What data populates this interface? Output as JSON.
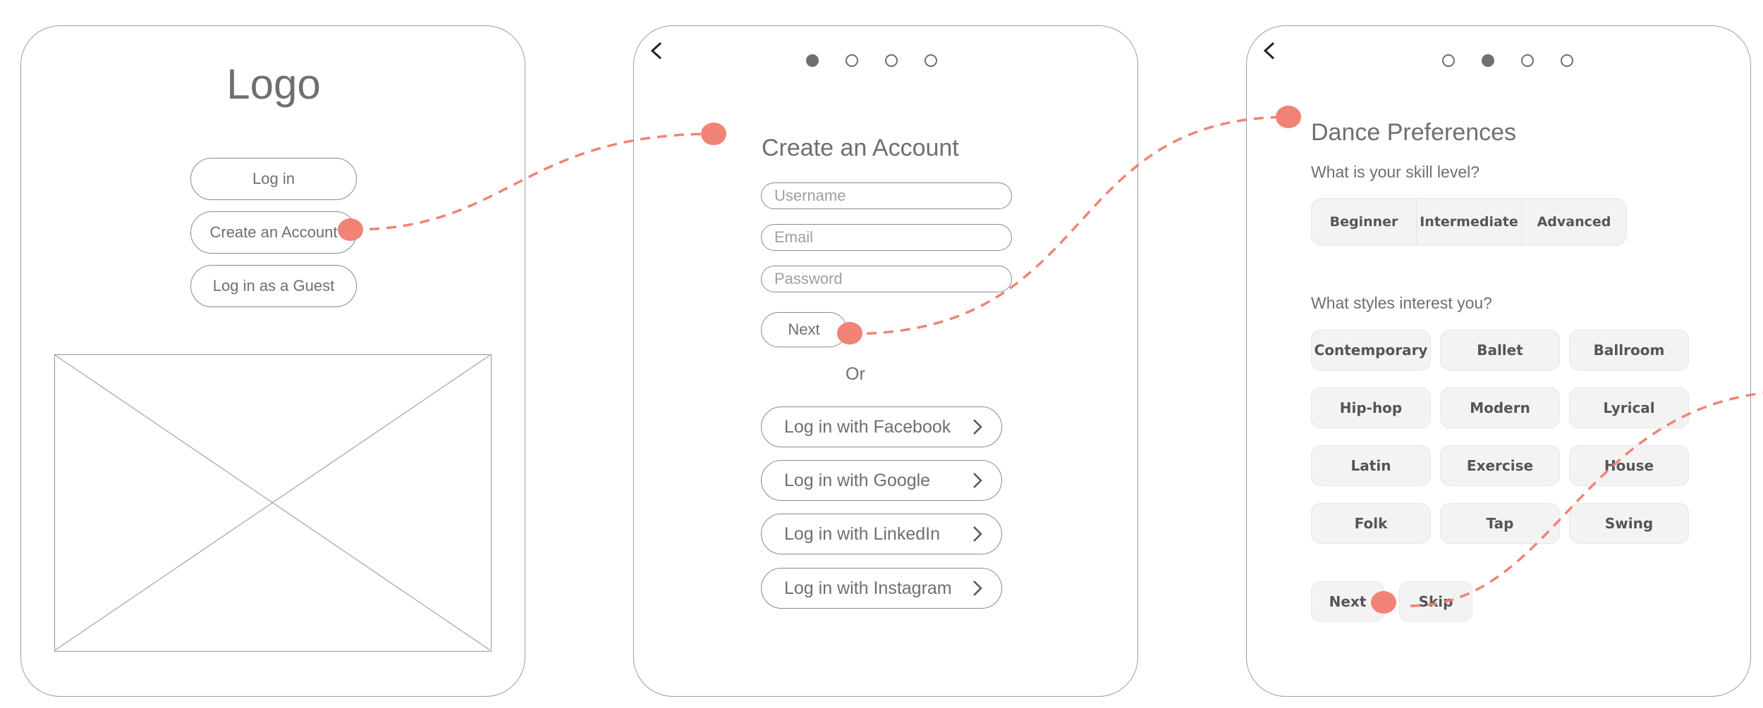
{
  "screen1": {
    "logo": "Logo",
    "buttons": [
      "Log in",
      "Create an Account",
      "Log in as a Guest"
    ]
  },
  "screen2": {
    "back_icon": "chevron-left-icon",
    "step_dots": [
      true,
      false,
      false,
      false
    ],
    "title": "Create an Account",
    "fields": [
      "Username",
      "Email",
      "Password"
    ],
    "next_label": "Next",
    "or_label": "Or",
    "social_buttons": [
      "Log in with Facebook",
      "Log in with Google",
      "Log in with LinkedIn",
      "Log in with Instagram"
    ]
  },
  "screen3": {
    "back_icon": "chevron-left-icon",
    "step_dots": [
      false,
      true,
      false,
      false
    ],
    "title": "Dance Preferences",
    "skill_question": "What is your skill level?",
    "skill_levels": [
      "Beginner",
      "Intermediate",
      "Advanced"
    ],
    "styles_question": "What styles interest you?",
    "styles": [
      "Contemporary",
      "Ballet",
      "Ballroom",
      "Hip-hop",
      "Modern",
      "Lyrical",
      "Latin",
      "Exercise",
      "House",
      "Folk",
      "Tap",
      "Swing"
    ],
    "next_label": "Next",
    "skip_label": "Skip"
  },
  "colors": {
    "flow_connector": "#f08375",
    "frame_border": "#8ea8a0",
    "chip_bg": "#f3f3f3"
  }
}
